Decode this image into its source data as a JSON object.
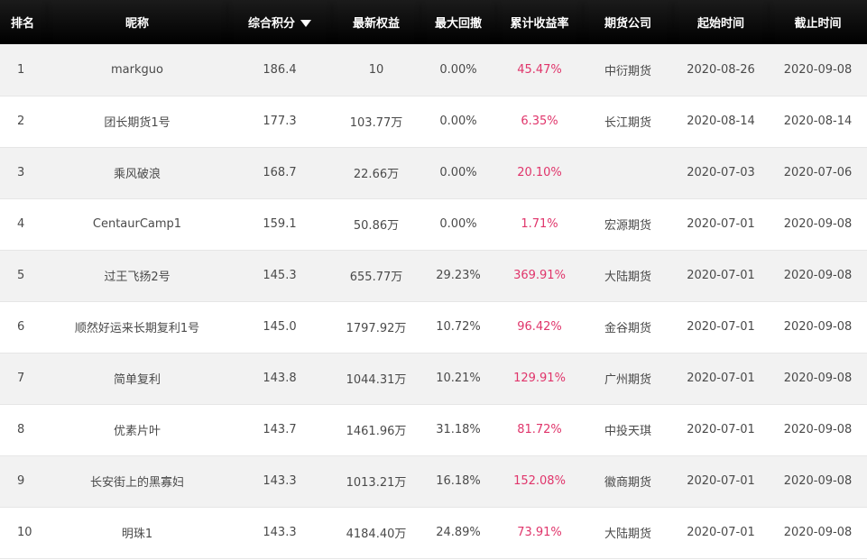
{
  "headers": {
    "rank": "排名",
    "nickname": "昵称",
    "score": "综合积分",
    "equity": "最新权益",
    "drawdown": "最大回撤",
    "return": "累计收益率",
    "company": "期货公司",
    "start": "起始时间",
    "end": "截止时间"
  },
  "sort": {
    "column": "score",
    "direction": "desc"
  },
  "colors": {
    "header_bg": "#000000",
    "return_text": "#e0356b",
    "row_alt": "#f2f2f2"
  },
  "rows": [
    {
      "rank": "1",
      "nickname": "markguo",
      "score": "186.4",
      "equity": "10",
      "drawdown": "0.00%",
      "return": "45.47%",
      "company": "中衍期货",
      "start": "2020-08-26",
      "end": "2020-09-08"
    },
    {
      "rank": "2",
      "nickname": "团长期货1号",
      "score": "177.3",
      "equity": "103.77万",
      "drawdown": "0.00%",
      "return": "6.35%",
      "company": "长江期货",
      "start": "2020-08-14",
      "end": "2020-08-14"
    },
    {
      "rank": "3",
      "nickname": "乘风破浪",
      "score": "168.7",
      "equity": "22.66万",
      "drawdown": "0.00%",
      "return": "20.10%",
      "company": "",
      "start": "2020-07-03",
      "end": "2020-07-06"
    },
    {
      "rank": "4",
      "nickname": "CentaurCamp1",
      "score": "159.1",
      "equity": "50.86万",
      "drawdown": "0.00%",
      "return": "1.71%",
      "company": "宏源期货",
      "start": "2020-07-01",
      "end": "2020-09-08"
    },
    {
      "rank": "5",
      "nickname": "过王飞扬2号",
      "score": "145.3",
      "equity": "655.77万",
      "drawdown": "29.23%",
      "return": "369.91%",
      "company": "大陆期货",
      "start": "2020-07-01",
      "end": "2020-09-08"
    },
    {
      "rank": "6",
      "nickname": "顺然好运来长期复利1号",
      "score": "145.0",
      "equity": "1797.92万",
      "drawdown": "10.72%",
      "return": "96.42%",
      "company": "金谷期货",
      "start": "2020-07-01",
      "end": "2020-09-08"
    },
    {
      "rank": "7",
      "nickname": "简单复利",
      "score": "143.8",
      "equity": "1044.31万",
      "drawdown": "10.21%",
      "return": "129.91%",
      "company": "广州期货",
      "start": "2020-07-01",
      "end": "2020-09-08"
    },
    {
      "rank": "8",
      "nickname": "优素片叶",
      "score": "143.7",
      "equity": "1461.96万",
      "drawdown": "31.18%",
      "return": "81.72%",
      "company": "中投天琪",
      "start": "2020-07-01",
      "end": "2020-09-08"
    },
    {
      "rank": "9",
      "nickname": "长安街上的黑寡妇",
      "score": "143.3",
      "equity": "1013.21万",
      "drawdown": "16.18%",
      "return": "152.08%",
      "company": "徽商期货",
      "start": "2020-07-01",
      "end": "2020-09-08"
    },
    {
      "rank": "10",
      "nickname": "明珠1",
      "score": "143.3",
      "equity": "4184.40万",
      "drawdown": "24.89%",
      "return": "73.91%",
      "company": "大陆期货",
      "start": "2020-07-01",
      "end": "2020-09-08"
    }
  ]
}
